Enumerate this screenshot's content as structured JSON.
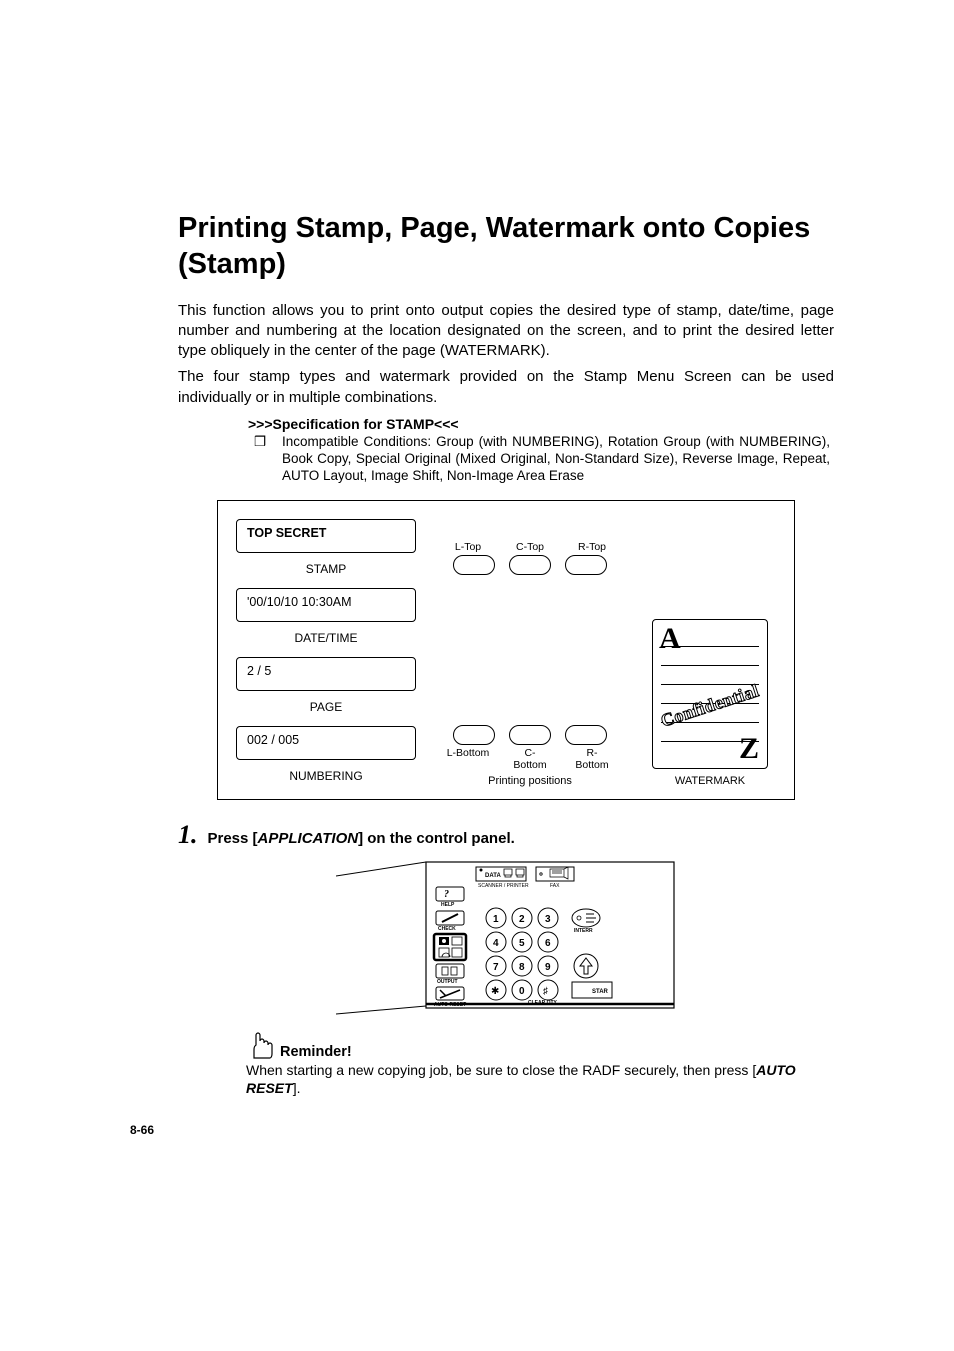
{
  "title": "Printing Stamp, Page, Watermark onto Copies (Stamp)",
  "intro1": "This function allows you to print onto output copies the desired type of stamp, date/time, page number and numbering at the location designated on the screen, and to print the desired letter type obliquely in the center of the page (WATERMARK).",
  "intro2": "The four stamp types and watermark provided on the Stamp Menu Screen can be used individually or in multiple combinations.",
  "spec": {
    "heading": ">>>Specification for STAMP<<<",
    "marker": "❒",
    "text": "Incompatible Conditions: Group (with NUMBERING), Rotation Group (with NUMBERING), Book Copy, Special Original (Mixed Original, Non-Standard Size), Reverse Image, Repeat, AUTO Layout, Image Shift, Non-Image Area Erase"
  },
  "diagram": {
    "cards": [
      {
        "value": "TOP SECRET",
        "bold": true,
        "caption": "STAMP"
      },
      {
        "value": "'00/10/10 10:30AM",
        "bold": false,
        "caption": "DATE/TIME"
      },
      {
        "value": "2 / 5",
        "bold": false,
        "caption": "PAGE"
      },
      {
        "value": "002 / 005",
        "bold": false,
        "caption": "NUMBERING"
      }
    ],
    "top_labels": [
      "L-Top",
      "C-Top",
      "R-Top"
    ],
    "bottom_labels": [
      "L-Bottom",
      "C-Bottom",
      "R-Bottom"
    ],
    "positions_caption": "Printing positions",
    "watermark": {
      "letterA": "A",
      "letterZ": "Z",
      "confidential": "Confidential",
      "caption": "WATERMARK"
    }
  },
  "step": {
    "num": "1.",
    "pre": "Press [",
    "btn": "APPLICATION",
    "post": "] on the control panel."
  },
  "panel": {
    "labels": {
      "data": "DATA",
      "scanner": "SCANNER / PRINTER",
      "fax": "FAX",
      "help": "HELP",
      "check": "CHECK",
      "output": "OUTPUT",
      "autoreset": "AUTO RESET",
      "interr": "INTERR",
      "star": "STAR",
      "clearqty": "CLEAR QTY."
    },
    "keys": [
      "1",
      "2",
      "3",
      "4",
      "5",
      "6",
      "7",
      "8",
      "9",
      "✱",
      "0",
      "♯"
    ]
  },
  "reminder": {
    "label": "Reminder!",
    "text_pre": "When starting a new copying job, be sure to close the RADF securely, then press [",
    "btn": "AUTO RESET",
    "text_post": "]."
  },
  "pagenum": "8-66"
}
